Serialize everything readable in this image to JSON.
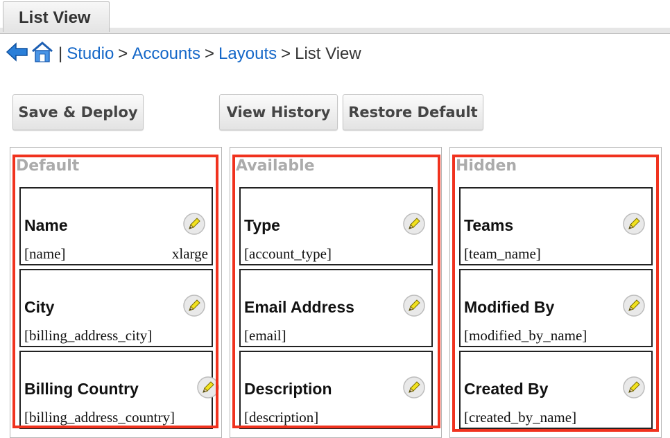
{
  "tab": {
    "label": "List View"
  },
  "breadcrumb": {
    "back_icon": "back-arrow-icon",
    "home_icon": "home-icon",
    "separator": "|",
    "items": [
      {
        "label": "Studio",
        "link": true
      },
      {
        "label": "Accounts",
        "link": true
      },
      {
        "label": "Layouts",
        "link": true
      },
      {
        "label": "List View",
        "link": false
      }
    ],
    "arrow": ">"
  },
  "buttons": {
    "save_deploy": "Save & Deploy",
    "view_history": "View History",
    "restore_default": "Restore Default"
  },
  "columns": [
    {
      "title": "Default",
      "fields": [
        {
          "label": "Name",
          "name": "[name]",
          "width": "xlarge"
        },
        {
          "label": "City",
          "name": "[billing_address_city]",
          "width": ""
        },
        {
          "label": "Billing Country",
          "name": "[billing_address_country]",
          "width": ""
        }
      ]
    },
    {
      "title": "Available",
      "fields": [
        {
          "label": "Type",
          "name": "[account_type]",
          "width": ""
        },
        {
          "label": "Email Address",
          "name": "[email]",
          "width": ""
        },
        {
          "label": "Description",
          "name": "[description]",
          "width": ""
        }
      ]
    },
    {
      "title": "Hidden",
      "fields": [
        {
          "label": "Teams",
          "name": "[team_name]",
          "width": ""
        },
        {
          "label": "Modified By",
          "name": "[modified_by_name]",
          "width": ""
        },
        {
          "label": "Created By",
          "name": "[created_by_name]",
          "width": ""
        }
      ]
    }
  ],
  "colors": {
    "link": "#1467c8",
    "highlight": "#f0321e",
    "column_title": "#ababab"
  },
  "icons": {
    "edit": "pencil-edit-icon"
  }
}
